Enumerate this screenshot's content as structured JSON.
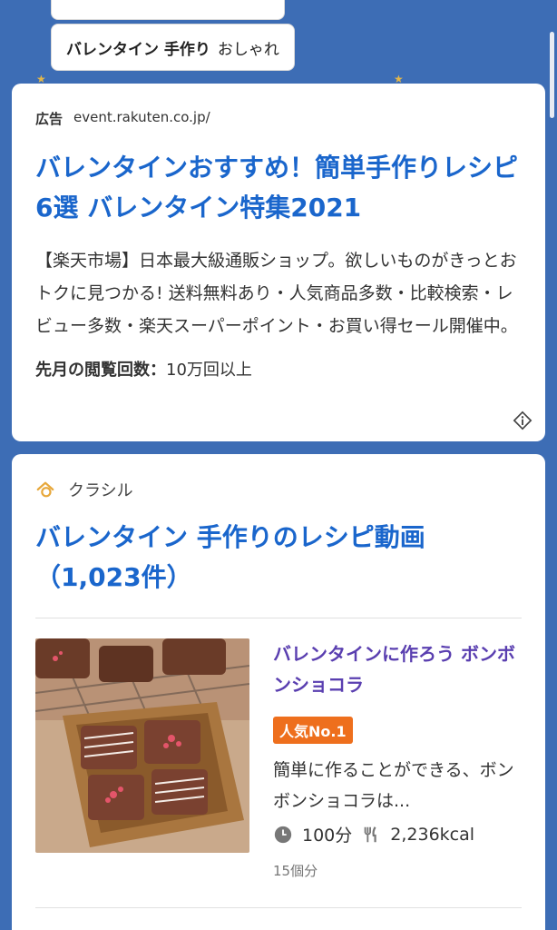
{
  "suggest": {
    "chip_bold": "バレンタイン 手作り",
    "chip_rest": "おしゃれ"
  },
  "ad": {
    "tag": "広告",
    "domain": "event.rakuten.co.jp/",
    "title": "バレンタインおすすめ！簡単手作りレシピ6選 バレンタイン特集2021",
    "description": "【楽天市場】日本最大級通販ショップ。欲しいものがきっとおトクに見つかる! 送料無料あり・人気商品多数・比較検索・レビュー多数・楽天スーパーポイント・お買い得セール開催中。",
    "views_label": "先月の閲覧回数：",
    "views_value": "10万回以上"
  },
  "recipe": {
    "source": "クラシル",
    "title": "バレンタイン 手作りのレシピ動画（1,023件）",
    "item_title": "バレンタインに作ろう ボンボンショコラ",
    "badge": "人気No.1",
    "snippet": "簡単に作ることができる、ボンボンショコラは...",
    "time": "100分",
    "calories": "2,236kcal",
    "count": "15個分"
  },
  "colors": {
    "background": "#3d6db5",
    "link": "#1a66cc",
    "item_title": "#5a3fb0",
    "badge": "#ee6f1d"
  },
  "icons": [
    "info-icon",
    "kurashiru-logo-icon",
    "clock-icon",
    "fork-knife-icon"
  ]
}
